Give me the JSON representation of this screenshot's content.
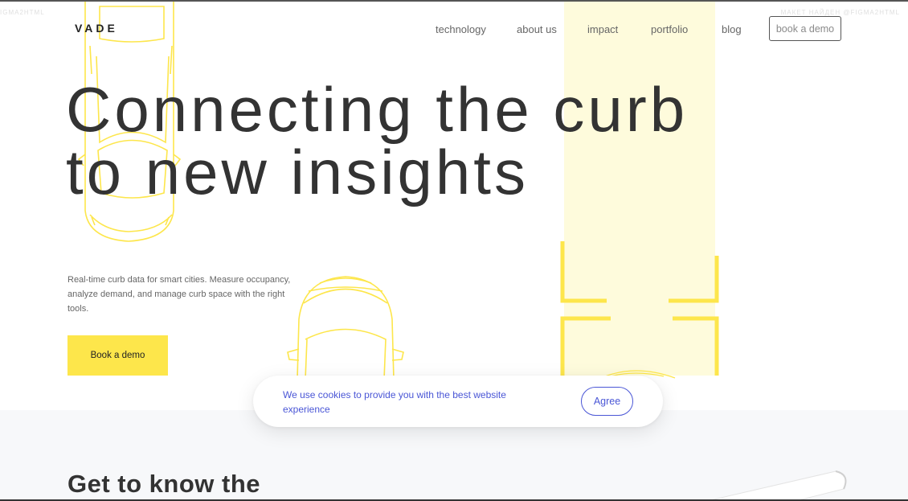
{
  "watermark": {
    "left": "IGMA2HTML",
    "right": "МАКЕТ НАЙДЕН @FIGMA2HTML"
  },
  "header": {
    "logo": "VADE",
    "nav": [
      "technology",
      "about us",
      "impact",
      "portfolio",
      "blog"
    ],
    "demo_button": "book a demo"
  },
  "hero": {
    "headline_line1": "Connecting the curb",
    "headline_line2": "to new insights",
    "description": "Real-time curb data for smart cities. Measure occupancy, analyze demand, and manage curb space with the right tools.",
    "cta_label": "Book a demo"
  },
  "cookie_banner": {
    "message": "We use cookies to provide you with the best website experience",
    "agree_label": "Agree"
  },
  "section": {
    "title": "Get to know the"
  },
  "colors": {
    "accent_yellow": "#fde64b",
    "pale_yellow": "#fefbdc",
    "cookie_blue": "#4a56d6",
    "text_dark": "#333333",
    "lower_bg": "#f7f8fa"
  },
  "icons": {
    "car_outline": "car-outline-icon",
    "parking_bracket": "parking-bracket-icon"
  }
}
